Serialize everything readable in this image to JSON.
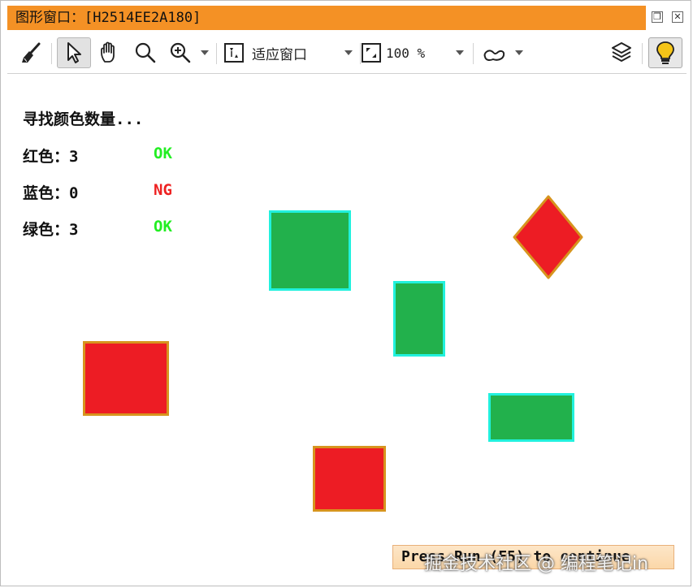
{
  "window": {
    "title": "图形窗口：[H2514EE2A180]",
    "title_bar_color": "#f49125"
  },
  "toolbar": {
    "icons": [
      "broom-icon",
      "pointer-icon",
      "hand-icon",
      "magnify-icon",
      "zoom-in-icon",
      "fit-window-icon",
      "zoom-percent-icon",
      "shape-icon",
      "layers-icon",
      "lightbulb-icon"
    ],
    "fit_label": "适应窗口",
    "zoom_value": "100 %"
  },
  "report": {
    "heading": "寻找颜色数量...",
    "rows": [
      {
        "label": "红色：3",
        "status": "OK",
        "status_color": "#22ee22"
      },
      {
        "label": "蓝色：0",
        "status": "NG",
        "status_color": "#ee2222"
      },
      {
        "label": "绿色：3",
        "status": "OK",
        "status_color": "#22ee22"
      }
    ]
  },
  "shapes": {
    "colors": {
      "green_fill": "#22b14c",
      "green_border": "#21f1dd",
      "red_fill": "#ed1c24",
      "red_border": "#d7941e"
    }
  },
  "footer": {
    "press_text": "Press Run (F5) to continue",
    "watermark": "掘金技术社区 @ 编程笔记in"
  }
}
